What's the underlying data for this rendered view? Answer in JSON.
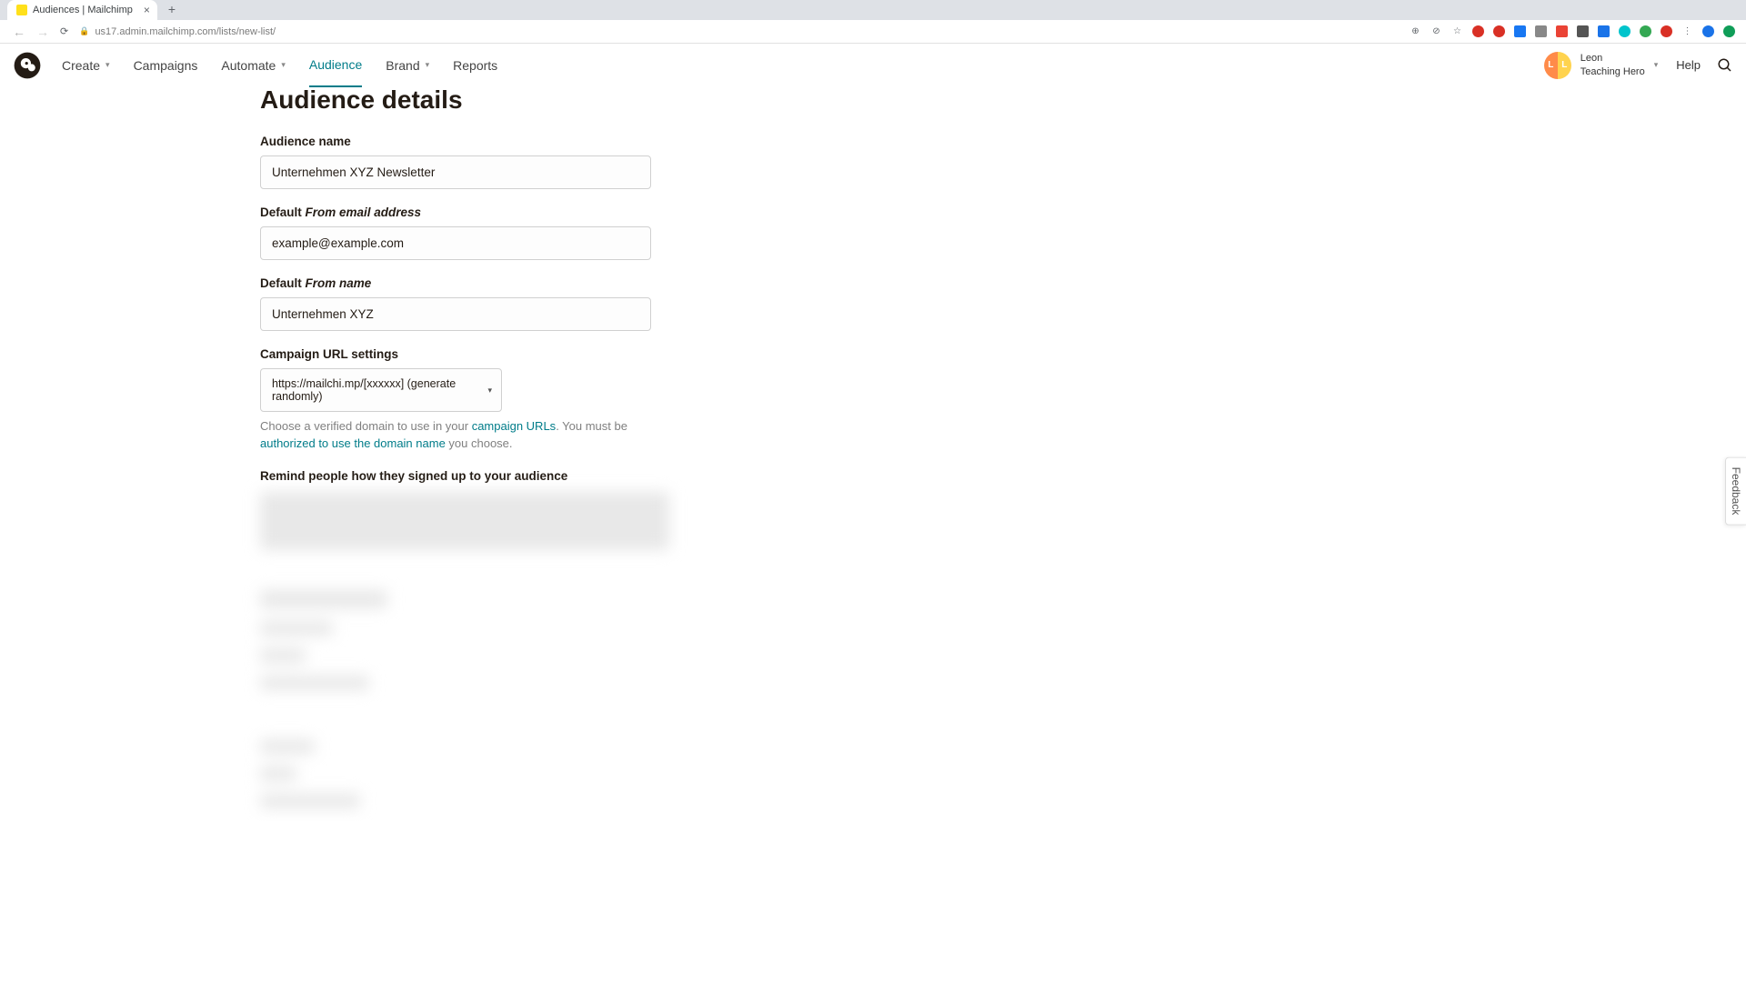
{
  "browser": {
    "tab_title": "Audiences | Mailchimp",
    "url": "us17.admin.mailchimp.com/lists/new-list/",
    "close_glyph": "×",
    "new_tab_glyph": "+",
    "back_glyph": "←",
    "fwd_glyph": "→",
    "reload_glyph": "⟳",
    "star_glyph": "☆"
  },
  "nav": {
    "create": "Create",
    "campaigns": "Campaigns",
    "automate": "Automate",
    "audience": "Audience",
    "brand": "Brand",
    "reports": "Reports"
  },
  "account": {
    "name": "Leon",
    "org": "Teaching Hero",
    "initial1": "L",
    "initial2": "L",
    "help": "Help"
  },
  "page": {
    "title": "Audience details",
    "audience_name_label": "Audience name",
    "audience_name_value": "Unternehmen XYZ Newsletter",
    "from_email_label_pre": "Default ",
    "from_email_label_em": "From email address",
    "from_email_value": "example@example.com",
    "from_name_label_pre": "Default ",
    "from_name_label_em": "From name",
    "from_name_value": "Unternehmen XYZ",
    "url_settings_label": "Campaign URL settings",
    "url_select_value": "https://mailchi.mp/[xxxxxx] (generate randomly)",
    "url_helper_1": "Choose a verified domain to use in your ",
    "url_helper_link1": "campaign URLs",
    "url_helper_2": ". You must be ",
    "url_helper_link2": "authorized to use the domain name",
    "url_helper_3": " you choose.",
    "remind_label": "Remind people how they signed up to your audience"
  },
  "feedback": "Feedback"
}
